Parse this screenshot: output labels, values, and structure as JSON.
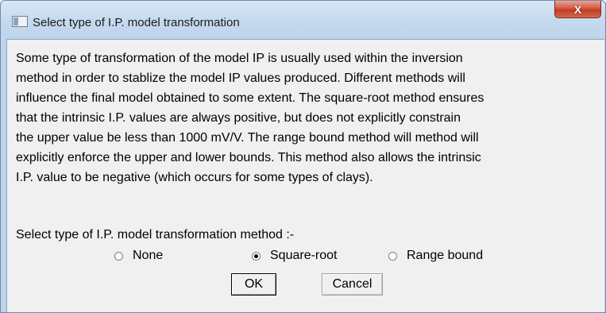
{
  "window": {
    "title": "Select type of I.P. model transformation",
    "close_glyph": "X"
  },
  "message": {
    "lines": [
      "Some type of transformation of the model IP is usually used within the inversion",
      "method in order to stablize the model IP values produced. Different methods will",
      "influence the final model obtained to some extent. The square-root method ensures",
      "that the intrinsic I.P. values are always positive, but does not explicitly constrain",
      "the upper value be less than 1000 mV/V. The range bound method will method will",
      "explicitly enforce the upper and lower bounds. This method also allows the intrinsic",
      "I.P. value to be negative (which occurs for some types of clays)."
    ]
  },
  "prompt": "Select type of I.P. model transformation method :-",
  "options": [
    {
      "label": "None",
      "selected": false
    },
    {
      "label": "Square-root",
      "selected": true
    },
    {
      "label": "Range bound",
      "selected": false
    }
  ],
  "buttons": {
    "ok": "OK",
    "cancel": "Cancel"
  }
}
